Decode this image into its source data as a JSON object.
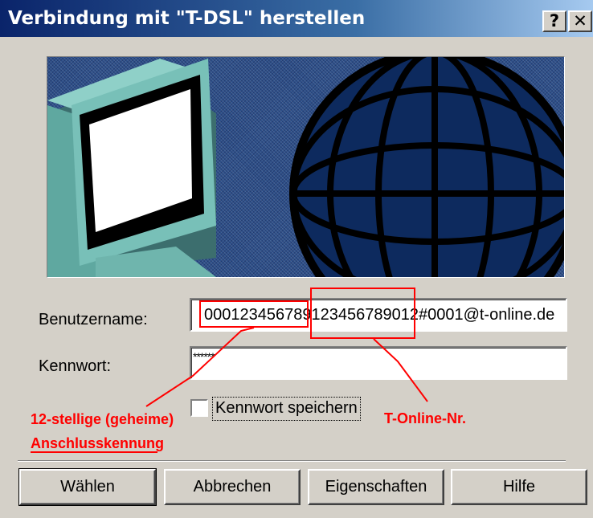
{
  "window": {
    "title": "Verbindung mit \"T-DSL\" herstellen",
    "help_glyph": "?",
    "close_glyph": "✕"
  },
  "form": {
    "username_label": "Benutzername:",
    "username_value": "000123456789123456789012#0001@t-online.de",
    "password_label": "Kennwort:",
    "password_value": "******",
    "save_password_label": "Kennwort speichern",
    "save_password_checked": false
  },
  "annotations": {
    "left_line1": "12-stellige (geheime)",
    "left_line2": "Anschlusskennung",
    "right": "T-Online-Nr.",
    "color": "#ff0000"
  },
  "buttons": {
    "dial": "Wählen",
    "cancel": "Abbrechen",
    "properties": "Eigenschaften",
    "help": "Hilfe"
  },
  "colors": {
    "titlebar_start": "#0a246a",
    "dialog_bg": "#d4d0c8",
    "banner_bg": "#2d4f88"
  },
  "icons": {
    "banner": "computer-and-globe-illustration",
    "help": "help-icon",
    "close": "close-icon"
  }
}
